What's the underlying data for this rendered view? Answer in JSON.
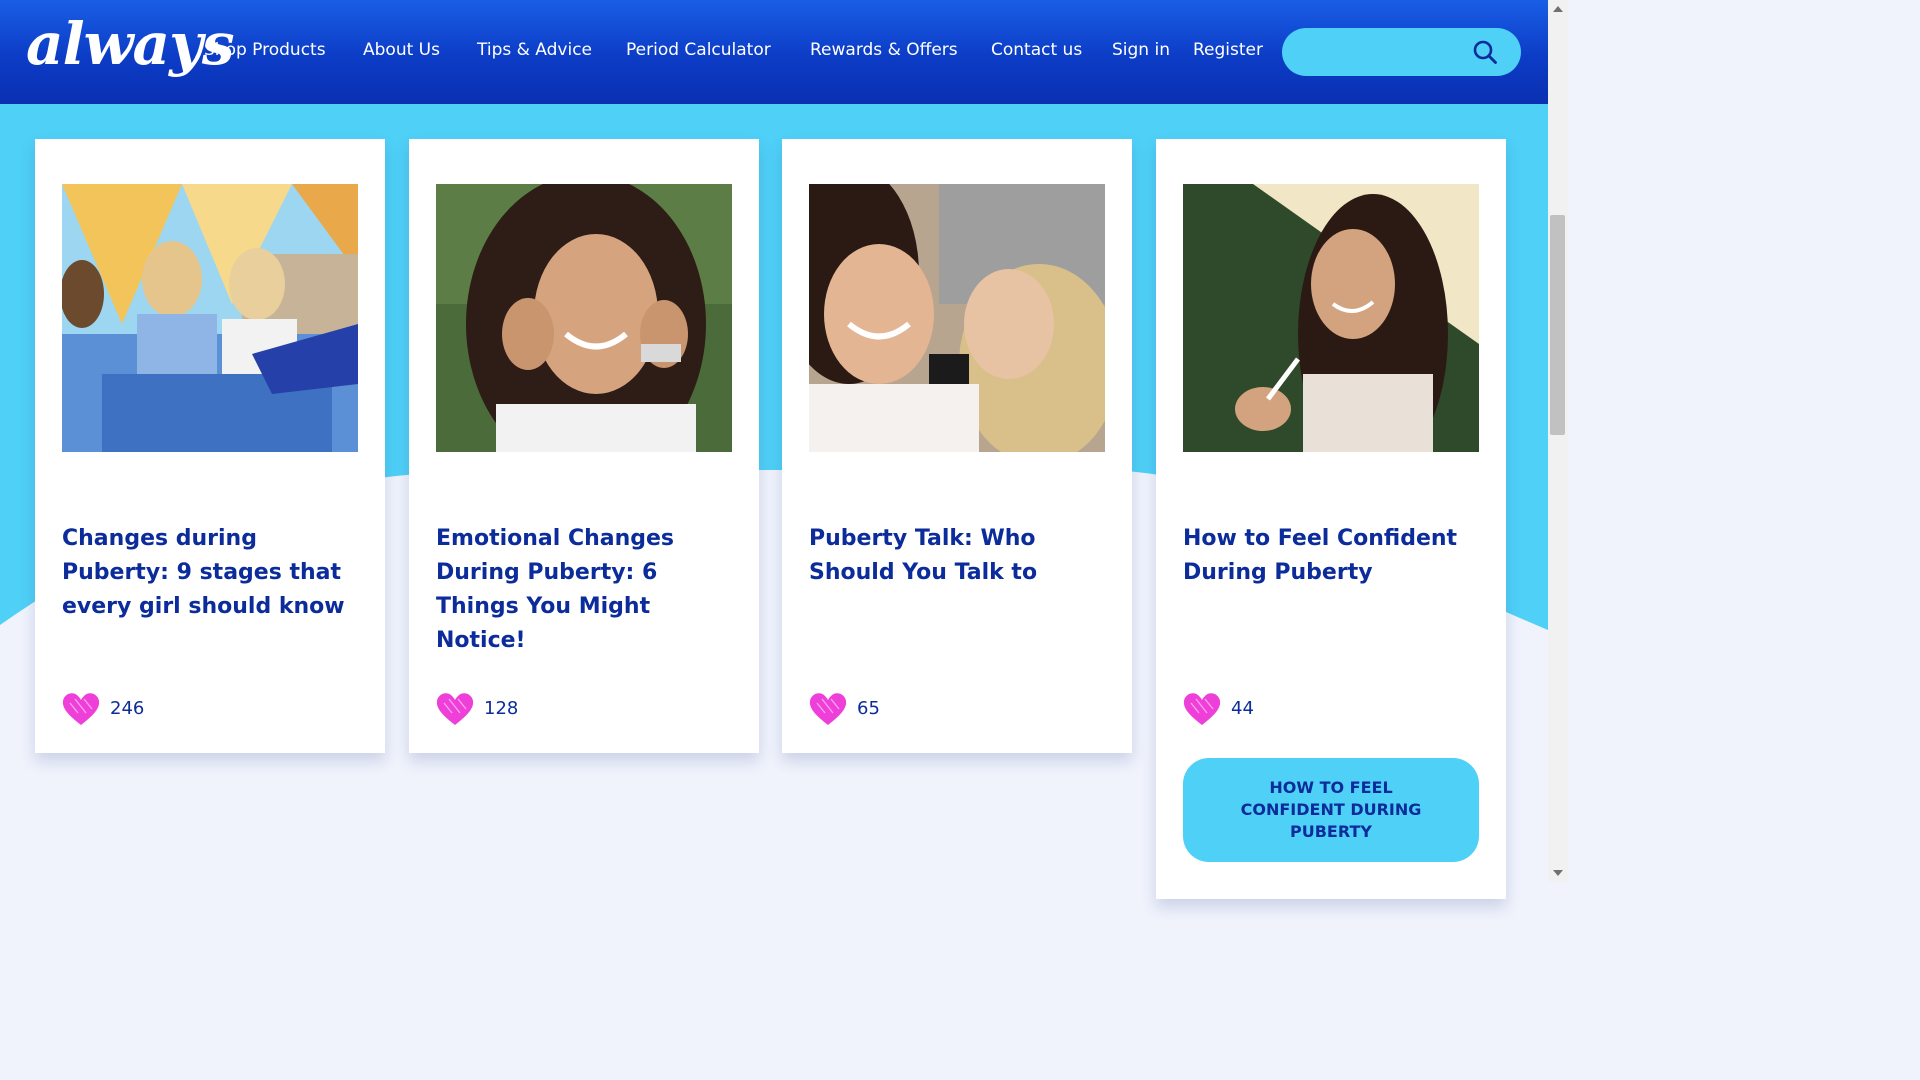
{
  "brand": {
    "logo_text": "always"
  },
  "nav": {
    "items": [
      "Shop Products",
      "About Us",
      "Tips & Advice",
      "Period Calculator",
      "Rewards & Offers",
      "Contact us",
      "Sign in",
      "Register"
    ]
  },
  "search": {
    "placeholder": "",
    "icon": "search-icon"
  },
  "colors": {
    "header_blue": "#0c3cc6",
    "accent_cyan": "#4fd0f7",
    "title_navy": "#0b2c9a",
    "heart_pink": "#ee3fd8",
    "page_bg": "#f0f3fc"
  },
  "cards": [
    {
      "title": "Changes during Puberty: 9 stages that every girl should know",
      "likes": "246",
      "heart_icon": "heart-icon"
    },
    {
      "title": "Emotional Changes During Puberty: 6 Things You Might Notice!",
      "likes": "128",
      "heart_icon": "heart-icon"
    },
    {
      "title": "Puberty Talk: Who Should You Talk to",
      "likes": "65",
      "heart_icon": "heart-icon"
    },
    {
      "title": "How to Feel Confident During Puberty",
      "likes": "44",
      "heart_icon": "heart-icon",
      "button_label": "HOW TO FEEL CONFIDENT DURING PUBERTY"
    }
  ]
}
